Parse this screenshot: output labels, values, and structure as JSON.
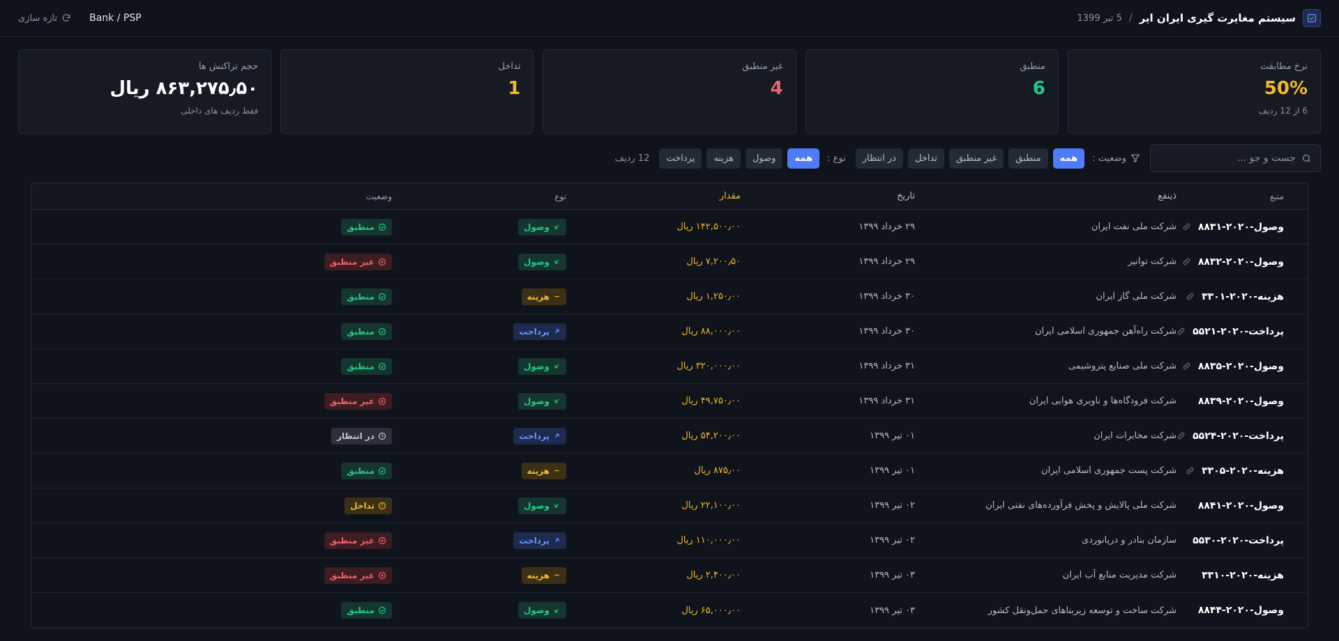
{
  "header": {
    "title": "سیستم مغایرت گیری ایران ایر",
    "separator": "/",
    "date": "5 تیر 1399",
    "bank_label": "Bank / PSP",
    "refresh_label": "تازه سازی"
  },
  "cards": [
    {
      "label": "نرخ مطابقت",
      "value": "50%",
      "sub": "6 از 12 ردیف",
      "color": "#f5b829"
    },
    {
      "label": "منطبق",
      "value": "6",
      "sub": "",
      "color": "#22c98a"
    },
    {
      "label": "غیر منطبق",
      "value": "4",
      "sub": "",
      "color": "#f0606a"
    },
    {
      "label": "تداخل",
      "value": "1",
      "sub": "",
      "color": "#f5b829"
    },
    {
      "label": "حجم تراکنش ها",
      "value": "۸۶۳,۲۷۵٫۵۰ ریال",
      "sub": "فقط ردیف های داخلی",
      "color": "#ffffff"
    }
  ],
  "filters": {
    "search_placeholder": "جست و جو ...",
    "status_label": "وضعیت :",
    "status_options": [
      "همه",
      "منطبق",
      "غیر منطبق",
      "تداخل",
      "در انتظار"
    ],
    "type_label": "نوع :",
    "type_options": [
      "همه",
      "وصول",
      "هزینه",
      "پرداخت"
    ],
    "rows_count": "12 ردیف"
  },
  "table": {
    "columns": {
      "source": "منبع",
      "beneficiary": "ذینفع",
      "date": "تاریخ",
      "amount": "مقدار",
      "type": "نوع",
      "status": "وضعیت"
    },
    "rows": [
      {
        "source": "وصول-۲۰۲۰-۸۸۳۱",
        "linked": true,
        "beneficiary": "شرکت ملی نفت ایران",
        "date": "۲۹ خرداد ۱۳۹۹",
        "amount": "۱۴۲,۵۰۰٫۰۰ ریال",
        "type": "وصول",
        "type_kind": "receipt",
        "status": "منطبق",
        "status_kind": "match"
      },
      {
        "source": "وصول-۲۰۲۰-۸۸۳۲",
        "linked": true,
        "beneficiary": "شرکت توانیر",
        "date": "۲۹ خرداد ۱۳۹۹",
        "amount": "۷,۲۰۰٫۵۰ ریال",
        "type": "وصول",
        "type_kind": "receipt",
        "status": "غیر منطبق",
        "status_kind": "nomatch"
      },
      {
        "source": "هزینه-۲۰۲۰-۳۳۰۱",
        "linked": true,
        "beneficiary": "شرکت ملی گاز ایران",
        "date": "۳۰ خرداد ۱۳۹۹",
        "amount": "۱,۲۵۰٫۰۰ ریال",
        "type": "هزینه",
        "type_kind": "expense",
        "status": "منطبق",
        "status_kind": "match"
      },
      {
        "source": "پرداخت-۲۰۲۰-۵۵۲۱",
        "linked": true,
        "beneficiary": "شرکت راه‌آهن جمهوری اسلامی ایران",
        "date": "۳۰ خرداد ۱۳۹۹",
        "amount": "۸۸,۰۰۰٫۰۰ ریال",
        "type": "پرداخت",
        "type_kind": "payment",
        "status": "منطبق",
        "status_kind": "match"
      },
      {
        "source": "وصول-۲۰۲۰-۸۸۳۵",
        "linked": true,
        "beneficiary": "شرکت ملی صنایع پتروشیمی",
        "date": "۳۱ خرداد ۱۳۹۹",
        "amount": "۳۲۰,۰۰۰٫۰۰ ریال",
        "type": "وصول",
        "type_kind": "receipt",
        "status": "منطبق",
        "status_kind": "match"
      },
      {
        "source": "وصول-۲۰۲۰-۸۸۳۹",
        "linked": false,
        "beneficiary": "شرکت فرودگاه‌ها و ناوبری هوایی ایران",
        "date": "۳۱ خرداد ۱۳۹۹",
        "amount": "۴۹,۷۵۰٫۰۰ ریال",
        "type": "وصول",
        "type_kind": "receipt",
        "status": "غیر منطبق",
        "status_kind": "nomatch"
      },
      {
        "source": "پرداخت-۲۰۲۰-۵۵۲۴",
        "linked": true,
        "beneficiary": "شرکت مخابرات ایران",
        "date": "۰۱ تیر ۱۳۹۹",
        "amount": "۵۴,۲۰۰٫۰۰ ریال",
        "type": "پرداخت",
        "type_kind": "payment",
        "status": "در انتظار",
        "status_kind": "pending"
      },
      {
        "source": "هزینه-۲۰۲۰-۳۳۰۵",
        "linked": true,
        "beneficiary": "شرکت پست جمهوری اسلامی ایران",
        "date": "۰۱ تیر ۱۳۹۹",
        "amount": "۸۷۵٫۰۰ ریال",
        "type": "هزینه",
        "type_kind": "expense",
        "status": "منطبق",
        "status_kind": "match"
      },
      {
        "source": "وصول-۲۰۲۰-۸۸۴۱",
        "linked": false,
        "beneficiary": "شرکت ملی پالایش و پخش فرآورده‌های نفتی ایران",
        "date": "۰۲ تیر ۱۳۹۹",
        "amount": "۲۲,۱۰۰٫۰۰ ریال",
        "type": "وصول",
        "type_kind": "receipt",
        "status": "تداخل",
        "status_kind": "conflict"
      },
      {
        "source": "پرداخت-۲۰۲۰-۵۵۳۰",
        "linked": false,
        "beneficiary": "سازمان بنادر و دریانوردی",
        "date": "۰۲ تیر ۱۳۹۹",
        "amount": "۱۱۰,۰۰۰٫۰۰ ریال",
        "type": "پرداخت",
        "type_kind": "payment",
        "status": "غیر منطبق",
        "status_kind": "nomatch"
      },
      {
        "source": "هزینه-۲۰۲۰-۳۳۱۰",
        "linked": false,
        "beneficiary": "شرکت مدیریت منابع آب ایران",
        "date": "۰۳ تیر ۱۳۹۹",
        "amount": "۲,۴۰۰٫۰۰ ریال",
        "type": "هزینه",
        "type_kind": "expense",
        "status": "غیر منطبق",
        "status_kind": "nomatch"
      },
      {
        "source": "وصول-۲۰۲۰-۸۸۴۴",
        "linked": false,
        "beneficiary": "شرکت ساخت و توسعه زیربناهای حمل‌ونقل کشور",
        "date": "۰۳ تیر ۱۳۹۹",
        "amount": "۶۵,۰۰۰٫۰۰ ریال",
        "type": "وصول",
        "type_kind": "receipt",
        "status": "منطبق",
        "status_kind": "match"
      }
    ]
  }
}
